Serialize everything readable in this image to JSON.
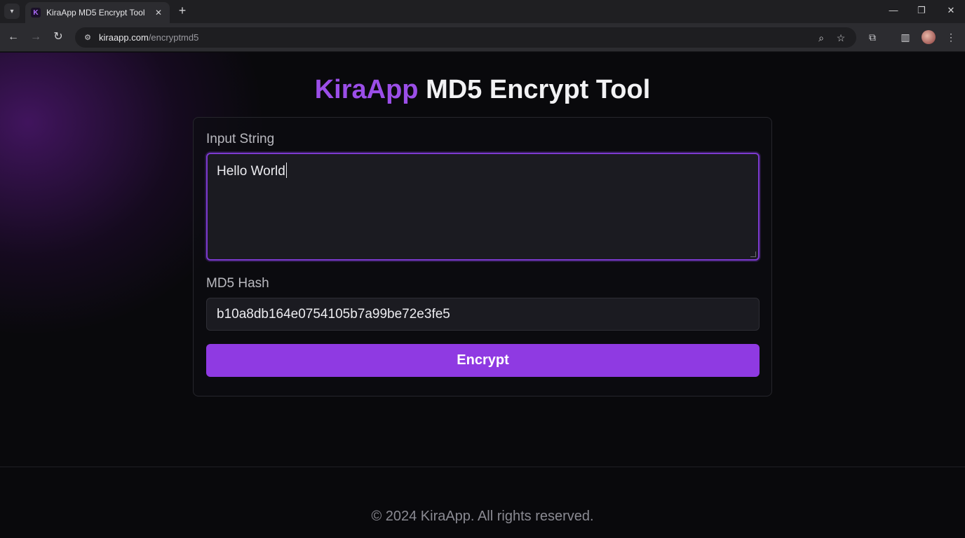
{
  "browser": {
    "tab_title": "KiraApp MD5 Encrypt Tool",
    "tab_favicon_letter": "K",
    "url_host": "kiraapp.com",
    "url_path": "/encryptmd5"
  },
  "page": {
    "heading_brand": "KiraApp",
    "heading_rest": " MD5 Encrypt Tool",
    "input_label": "Input String",
    "input_value": "Hello World",
    "hash_label": "MD5 Hash",
    "hash_value": "b10a8db164e0754105b7a99be72e3fe5",
    "encrypt_label": "Encrypt",
    "footer_text": "© 2024 KiraApp. All rights reserved."
  },
  "colors": {
    "brand": "#9b4ee8",
    "button": "#8f3ae2",
    "focus_border": "#7c3ad0"
  }
}
